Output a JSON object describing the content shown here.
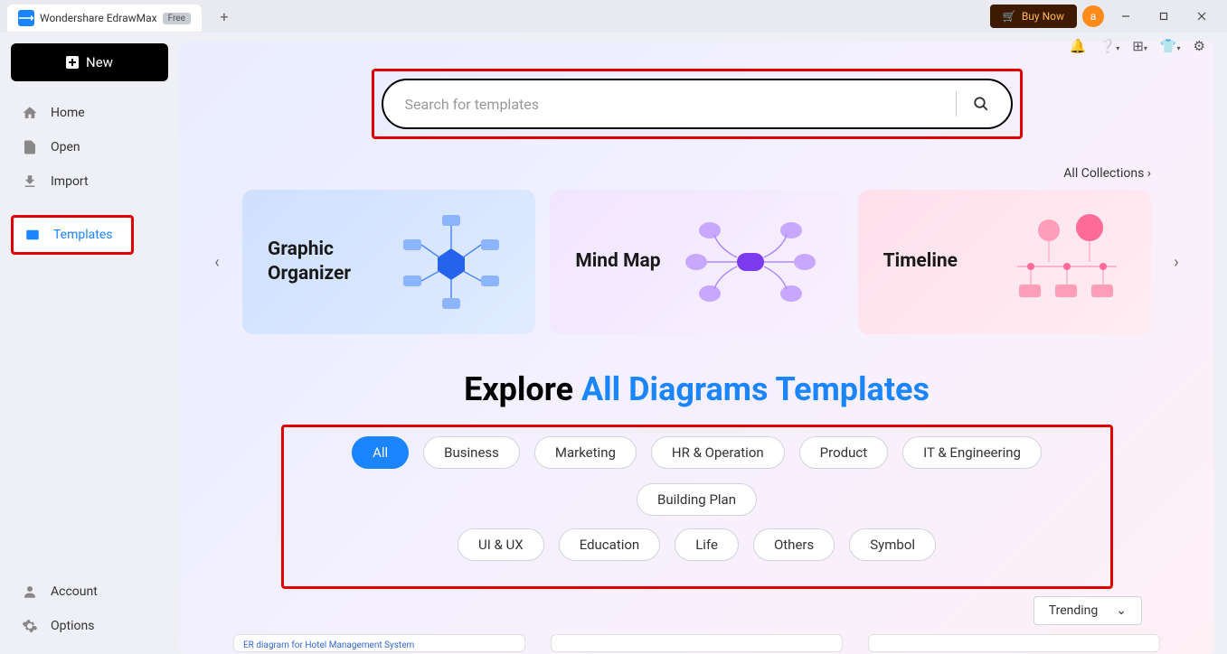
{
  "titlebar": {
    "app_name": "Wondershare EdrawMax",
    "badge": "Free",
    "buy_label": "Buy Now",
    "avatar_initial": "a"
  },
  "sidebar": {
    "new_label": "New",
    "items": [
      {
        "label": "Home"
      },
      {
        "label": "Open"
      },
      {
        "label": "Import"
      },
      {
        "label": "Templates"
      }
    ],
    "footer": [
      {
        "label": "Account"
      },
      {
        "label": "Options"
      }
    ]
  },
  "search": {
    "placeholder": "Search for templates"
  },
  "all_collections": "All Collections",
  "cards": [
    {
      "title": "Graphic\nOrganizer"
    },
    {
      "title": "Mind Map"
    },
    {
      "title": "Timeline"
    }
  ],
  "explore": {
    "prefix": "Explore ",
    "accent": "All Diagrams Templates"
  },
  "filters": {
    "row1": [
      "All",
      "Business",
      "Marketing",
      "HR & Operation",
      "Product",
      "IT & Engineering",
      "Building Plan"
    ],
    "row2": [
      "UI & UX",
      "Education",
      "Life",
      "Others",
      "Symbol"
    ]
  },
  "sort_label": "Trending",
  "template_preview": "ER diagram for Hotel Management System"
}
